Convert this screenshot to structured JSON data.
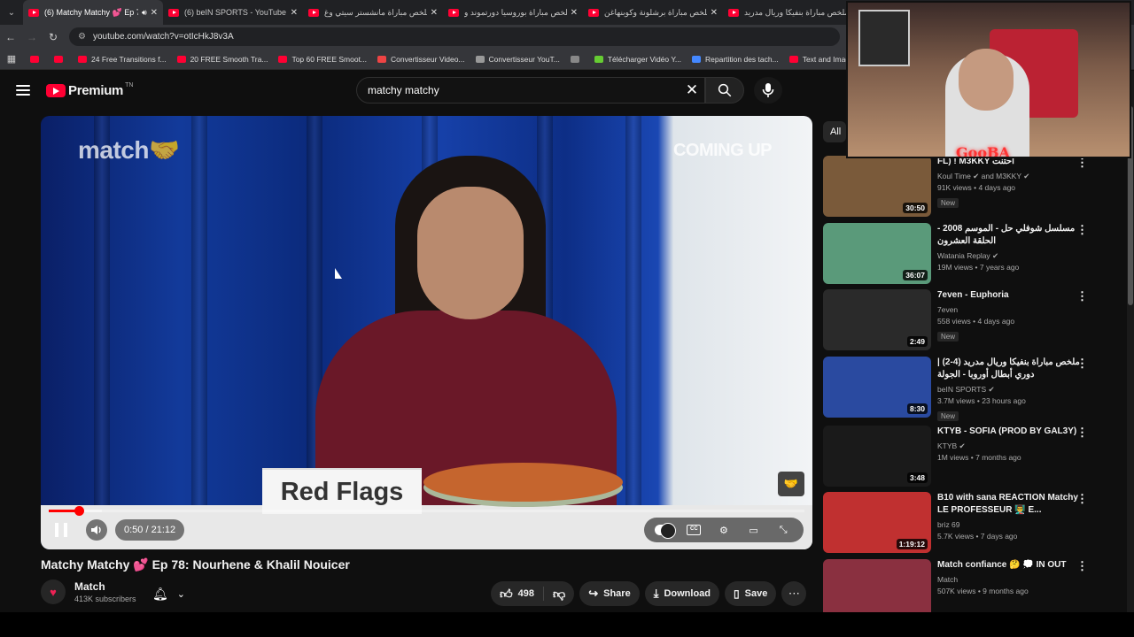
{
  "browser": {
    "tabs": [
      {
        "title": "(6) Matchy Matchy 💕 Ep 7",
        "active": true,
        "audio": true
      },
      {
        "title": "(6) beIN SPORTS - YouTube",
        "active": false
      },
      {
        "title": "ملخص مباراة مانشستر سيتي وغ",
        "active": false
      },
      {
        "title": "ملخص مباراة بوروسيا دورتموند و",
        "active": false
      },
      {
        "title": "ملخص مباراة برشلونة وكوبنهاغن",
        "active": false
      },
      {
        "title": "ملخص مباراة بنفيكا وريال مدريد",
        "active": false
      }
    ],
    "url": "youtube.com/watch?v=otIcHkJ8v3A",
    "bookmarks": [
      {
        "label": "",
        "color": "#ff0033"
      },
      {
        "label": "",
        "color": "#ff0033"
      },
      {
        "label": "24 Free Transitions f...",
        "color": "#ff0033"
      },
      {
        "label": "20 FREE Smooth Tra...",
        "color": "#ff0033"
      },
      {
        "label": "Top 60 FREE Smoot...",
        "color": "#ff0033"
      },
      {
        "label": "Convertisseur Video...",
        "color": "#e44"
      },
      {
        "label": "Convertisseur YouT...",
        "color": "#999"
      },
      {
        "label": "",
        "color": "#888"
      },
      {
        "label": "Télécharger Vidéo Y...",
        "color": "#6c3"
      },
      {
        "label": "Repartition des tach...",
        "color": "#48f"
      },
      {
        "label": "Text and Image ani...",
        "color": "#ff0033"
      }
    ]
  },
  "header": {
    "logo_text": "Premium",
    "logo_tm": "TN",
    "search_value": "matchy matchy",
    "clear_glyph": "✕"
  },
  "player": {
    "watermark": "match🤝",
    "coming_up": "COMING UP",
    "sign_text": "Red Flags",
    "time": "0:50 / 21:12",
    "progress_fraction": 0.04,
    "buffered_fraction": 0.07
  },
  "video": {
    "title": "Matchy Matchy 💕 Ep 78: Nourhene & Khalil Nouicer",
    "channel": "Match",
    "subscribers": "413K subscribers",
    "likes": "498",
    "share_label": "Share",
    "download_label": "Download",
    "save_label": "Save"
  },
  "sidebar": {
    "chip_label": "All",
    "items": [
      {
        "title": "FL) ! M3KKY احتنت",
        "meta1": "Koul Time ✔ and M3KKY ✔",
        "meta2": "91K views • 4 days ago",
        "badge": "New",
        "duration": "30:50",
        "thumb": "#7a5a3a"
      },
      {
        "title": "مسلسل شوفلي حل - الموسم 2008 - الحلقة العشرون",
        "meta1": "Watania Replay ✔",
        "meta2": "19M views • 7 years ago",
        "badge": "",
        "duration": "36:07",
        "thumb": "#5a9a7a"
      },
      {
        "title": "7even - Euphoria",
        "meta1": "7even",
        "meta2": "558 views • 4 days ago",
        "badge": "New",
        "duration": "2:49",
        "thumb": "#2a2a2a"
      },
      {
        "title": "ملخص مباراة بنفيكا وريال مدريد (4-2) | دوري أبطال أوروبا - الجولة",
        "meta1": "beIN SPORTS ✔",
        "meta2": "3.7M views • 23 hours ago",
        "badge": "New",
        "duration": "8:30",
        "thumb": "#2a4aa0"
      },
      {
        "title": "KTYB - SOFIA (PROD BY GAL3Y)",
        "meta1": "KTYB ✔",
        "meta2": "1M views • 7 months ago",
        "badge": "",
        "duration": "3:48",
        "thumb": "#1a1a1a"
      },
      {
        "title": "B10 with sana REACTION Matchy LE PROFESSEUR 👨‍🏫 E...",
        "meta1": "briz 69",
        "meta2": "5.7K views • 7 days ago",
        "badge": "",
        "duration": "1:19:12",
        "thumb": "#c03030"
      },
      {
        "title": "Match confiance 🤔 💭 IN OUT",
        "meta1": "Match",
        "meta2": "507K views • 9 months ago",
        "badge": "",
        "duration": "",
        "thumb": "#8a3040"
      }
    ]
  },
  "webcam": {
    "overlay_text": "GooBA"
  }
}
